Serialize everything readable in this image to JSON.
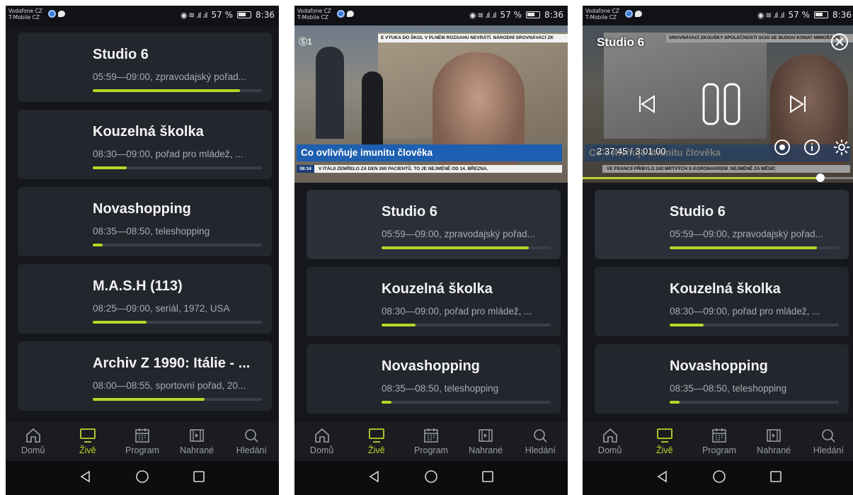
{
  "status_bar": {
    "carrier1": "Vodafone CZ",
    "carrier2": "T-Mobile CZ",
    "battery": "57 %",
    "time": "8:36"
  },
  "programs": [
    {
      "title": "Studio 6",
      "subtitle": "05:59—09:00, zpravodajský pořad...",
      "progress": 0.87
    },
    {
      "title": "Kouzelná školka",
      "subtitle": "08:30—09:00, pořad pro mládež, ...",
      "progress": 0.2
    },
    {
      "title": "Novashopping",
      "subtitle": "08:35—08:50, teleshopping",
      "progress": 0.06
    },
    {
      "title": "M.A.S.H (113)",
      "subtitle": "08:25—09:00, seriál, 1972, USA",
      "progress": 0.32
    },
    {
      "title": "Archiv Z 1990: Itálie - ...",
      "subtitle": "08:00—08:55, sportovní pořad, 20...",
      "progress": 0.66
    }
  ],
  "nav": [
    {
      "label": "Domů",
      "icon": "home-icon"
    },
    {
      "label": "Živě",
      "icon": "tv-icon"
    },
    {
      "label": "Program",
      "icon": "calendar-icon"
    },
    {
      "label": "Nahrané",
      "icon": "recorded-icon"
    },
    {
      "label": "Hledání",
      "icon": "search-icon"
    }
  ],
  "video": {
    "ticker_top": "E VÝUKA DO ŠKOL V PLNÉM ROZSAHU NEVRÁTÍ.   NÁRODNÍ SROVNÁVACÍ ZK",
    "caption": "Co ovlivňuje imunitu člověka",
    "ticker_time": "08:34",
    "ticker_bottom": "V ITÁLII ZEMŘELO ZA DEN 260 PACIENTŮ, TO JE NEJMÉNĚ OD 14. BŘEZNA.",
    "overlay_ticker_top": "SROVNÁVACÍ ZKOUŠKY SPOLEČNOSTI SCIO SE BUDOU KONAT MIMOŘÁDN",
    "overlay_ticker_bottom": "VE FRANCII PŘIBYLO 242 MRTVÝCH S KORONAVIREM. NEJMÉNĚ ZA MĚSÍC"
  },
  "player": {
    "title": "Studio 6",
    "time": "2:37:45 / 3:01:00",
    "seek_progress": 0.87
  },
  "colors": {
    "accent": "#b8d629",
    "card": "#23262c",
    "background": "#15171b"
  }
}
